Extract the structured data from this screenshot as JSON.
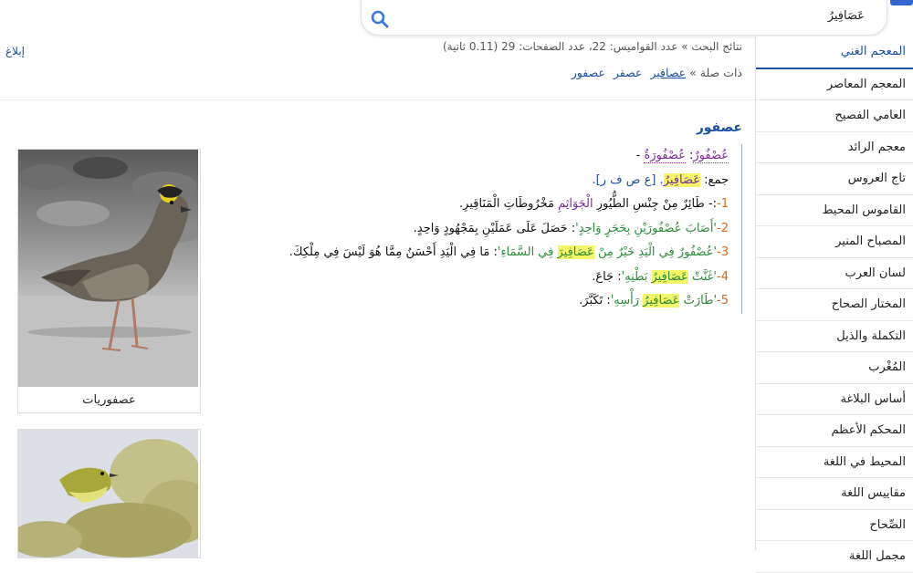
{
  "search": {
    "value": "عَصَافِيرُ"
  },
  "report_label": "إبلاغ",
  "stats_text": "نتائج البحث » عدد القواميس: 22، عدد الصفحات: 29 (0.11 ثانية)",
  "related": {
    "label": "ذات صلة »",
    "links": [
      "عصافير",
      "عصفر",
      "عصفور"
    ]
  },
  "sidebar": {
    "items": [
      {
        "label": "المعجم الغني"
      },
      {
        "label": "المعجم المعاصر"
      },
      {
        "label": "العامي الفصيح"
      },
      {
        "label": "معجم الرائد"
      },
      {
        "label": "تاج العروس"
      },
      {
        "label": "القاموس المحيط"
      },
      {
        "label": "المصباح المنير"
      },
      {
        "label": "لسان العرب"
      },
      {
        "label": "المختار الصحاح"
      },
      {
        "label": "التكملة والذيل"
      },
      {
        "label": "المُغْرب"
      },
      {
        "label": "أساس البلاغة"
      },
      {
        "label": "المحكم الأعظم"
      },
      {
        "label": "المحيط في اللغة"
      },
      {
        "label": "مقاييس اللغة"
      },
      {
        "label": "الصِّحاح"
      },
      {
        "label": "مجمل اللغة"
      }
    ]
  },
  "entry": {
    "title": "عصفور",
    "head": "عُصْفُورٌ",
    "head_sep": ":",
    "fem": "عُصْفُورَةٌ",
    "fem_tail": " -",
    "plural_label": "جمع:",
    "plural": "عَصَافِيرُ",
    "root": ". [ع ص ف ر].",
    "senses": [
      {
        "num": "1-",
        "parts": [
          {
            "t": ":- طَائِرٌ مِنْ جِنْسِ الطُّيُورِ ",
            "c": ""
          },
          {
            "t": "الْجَوَاثِمِ",
            "c": "purple"
          },
          {
            "t": " مَخْرُوطَاتِ الْمَنَاقِيرِ.",
            "c": ""
          }
        ]
      },
      {
        "num": "2-",
        "parts": [
          {
            "t": "'أَصَابَ عُصْفُورَيْنِ بِحَجَرٍ وَاحِدٍ'",
            "c": "green"
          },
          {
            "t": ": حَصَلَ عَلَى عَمَلَيْنِ بِمَجْهُودٍ وَاحِدٍ.",
            "c": ""
          }
        ]
      },
      {
        "num": "3-",
        "parts": [
          {
            "t": "'عُصْفُورٌ فِي الْيَدِ خَيْرٌ مِنْ ",
            "c": "green"
          },
          {
            "t": "عَصَافِيرَ",
            "c": "hlgreen"
          },
          {
            "t": " فِي السَّمَاءِ'",
            "c": "green"
          },
          {
            "t": ": مَا فِي الْيَدِ أَحْسَنُ مِمَّا هُوَ لَيْسَ فِي مِلْكِكَ.",
            "c": ""
          }
        ]
      },
      {
        "num": "4-",
        "parts": [
          {
            "t": "'غَنَّتْ ",
            "c": "green"
          },
          {
            "t": "عَصَافِيرُ",
            "c": "hlgreen"
          },
          {
            "t": " بَطْنِهِ'",
            "c": "green"
          },
          {
            "t": ": جَاعَ.",
            "c": ""
          }
        ]
      },
      {
        "num": "5-",
        "parts": [
          {
            "t": "'طَارَتْ ",
            "c": "green"
          },
          {
            "t": "عَصَافِيرُ",
            "c": "hlgreen"
          },
          {
            "t": " رَأْسِهِ'",
            "c": "green"
          },
          {
            "t": ": تَكَبَّرَ.",
            "c": ""
          }
        ]
      }
    ]
  },
  "figures": [
    {
      "caption": "عصفوريات"
    },
    {
      "caption": ""
    }
  ]
}
